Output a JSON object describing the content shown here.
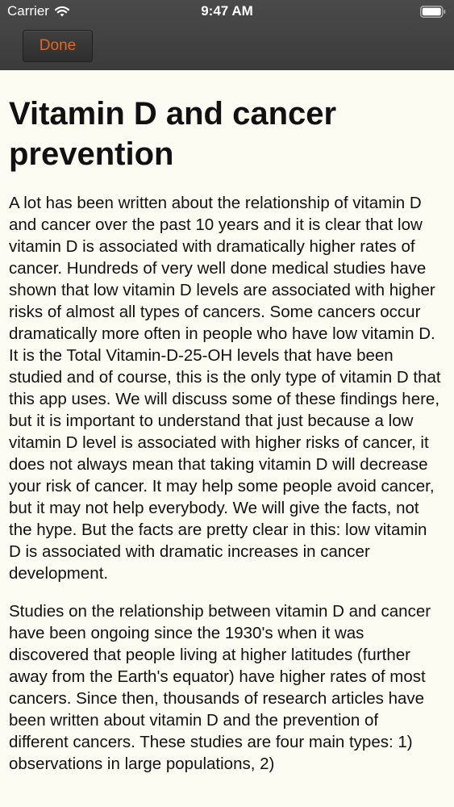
{
  "status_bar": {
    "carrier": "Carrier",
    "time": "9:47 AM"
  },
  "nav": {
    "done_label": "Done",
    "accent_color": "#e8651b"
  },
  "article": {
    "title": "Vitamin D and cancer prevention",
    "paragraphs": [
      "A lot has been written about the relationship of vitamin D and cancer over the past 10 years and it is clear that low vitamin D is associated with dramatically higher rates of cancer. Hundreds of very well done medical studies have shown that low vitamin D levels are associated with higher risks of almost all types of cancers. Some cancers occur dramatically more often in people who have low vitamin D. It is the Total Vitamin-D-25-OH levels that have been studied and of course, this is the only type of vitamin D that this app uses. We will discuss some of these findings here, but it is important to understand that just because a low vitamin D level is associated with higher risks of cancer, it does not always mean that taking vitamin D will decrease your risk of cancer. It may help some people avoid cancer, but it may not help everybody. We will give the facts, not the hype. But the facts are pretty clear in this: low vitamin D is associated with dramatic increases in cancer development.",
      "Studies on the relationship between vitamin D and cancer have been ongoing since the 1930's when it was discovered that people living at higher latitudes (further away from the Earth's equator) have higher rates of most cancers. Since then, thousands of research articles have been written about vitamin D and the prevention of different cancers. These studies are four main types: 1) observations in large populations, 2)"
    ]
  }
}
